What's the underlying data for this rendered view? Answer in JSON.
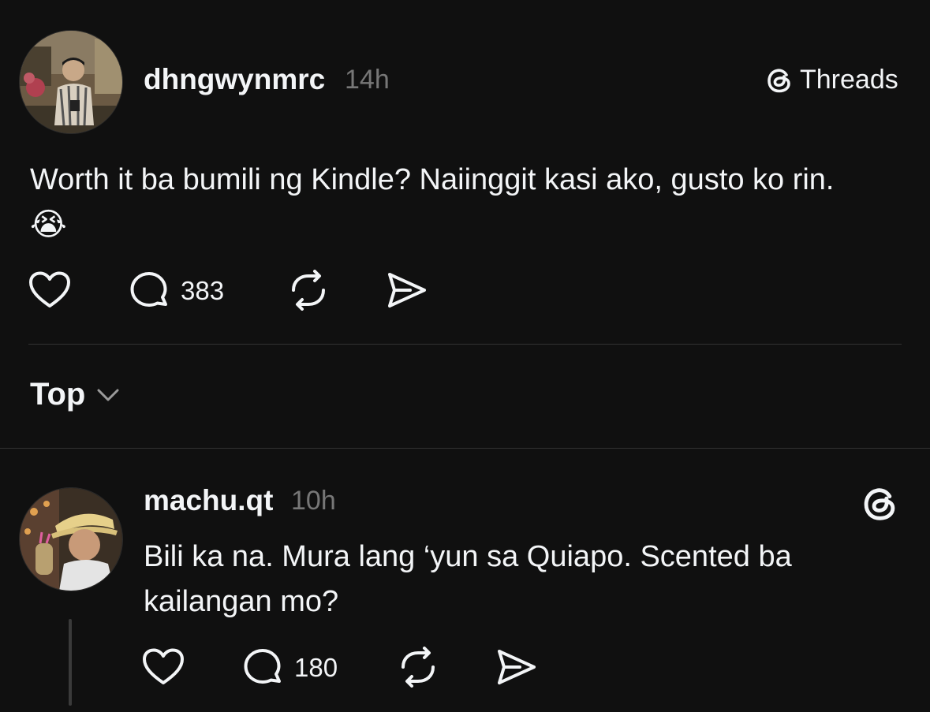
{
  "header": {
    "brand_label": "Threads",
    "brand_icon": "threads-logo-icon"
  },
  "post": {
    "username": "dhngwynmrc",
    "time": "14h",
    "text": "Worth it ba bumili ng Kindle? Naiinggit kasi ako, gusto ko rin.",
    "emoji": "😭",
    "actions": {
      "like_icon": "heart-icon",
      "reply_icon": "comment-icon",
      "reply_count": "383",
      "repost_icon": "repost-icon",
      "share_icon": "send-icon"
    }
  },
  "sort": {
    "label": "Top",
    "icon": "chevron-down-icon"
  },
  "reply": {
    "username": "machu.qt",
    "time": "10h",
    "text_line1": "Bili ka na. Mura lang ‘yun sa Quiapo. Scented ba",
    "text_line2": "kailangan mo?",
    "badge_icon": "threads-logo-icon",
    "actions": {
      "like_icon": "heart-icon",
      "reply_icon": "comment-icon",
      "reply_count": "180",
      "repost_icon": "repost-icon",
      "share_icon": "send-icon"
    }
  },
  "colors": {
    "background": "#101010",
    "text": "#f3f5f7",
    "muted": "#777777",
    "divider": "#323232"
  }
}
